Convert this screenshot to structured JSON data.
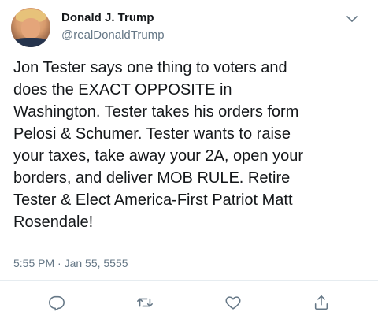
{
  "tweet": {
    "author_name": "Donald J. Trump",
    "author_handle": "@realDonaldTrump",
    "text": "Jon Tester says one thing to voters and\ndoes the EXACT OPPOSITE in\nWashington. Tester takes his orders form\nPelosi & Schumer. Tester wants to raise\nyour taxes, take away your 2A, open your\nborders, and deliver MOB RULE. Retire\nTester & Elect America-First Patriot Matt\nRosendale!",
    "timestamp": "5:55 PM · Jan 55, 5555"
  },
  "icons": {
    "menu": "chevron-down-icon",
    "reply": "reply-icon",
    "retweet": "retweet-icon",
    "like": "heart-icon",
    "share": "share-icon"
  },
  "colors": {
    "text_primary": "#14171a",
    "text_secondary": "#657786",
    "icon_gray": "#657786",
    "divider": "#e6ecf0"
  }
}
